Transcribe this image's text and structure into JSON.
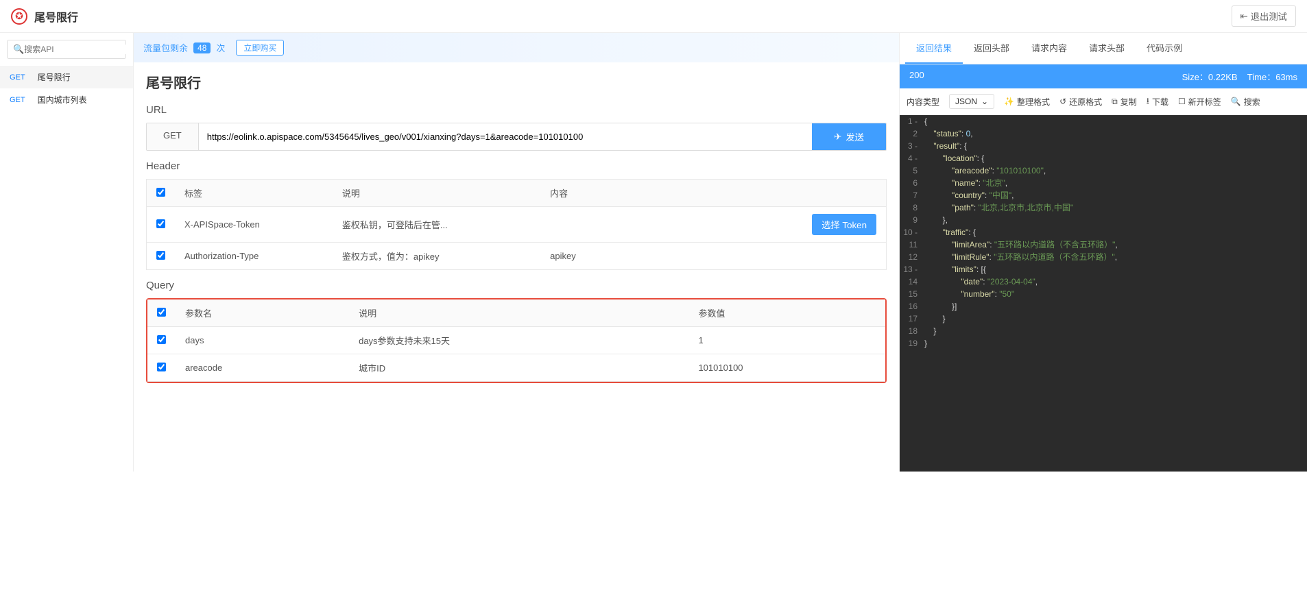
{
  "header": {
    "title": "尾号限行",
    "exit_label": "退出测试"
  },
  "sidebar": {
    "search_placeholder": "搜索API",
    "items": [
      {
        "method": "GET",
        "name": "尾号限行",
        "active": true
      },
      {
        "method": "GET",
        "name": "国内城市列表",
        "active": false
      }
    ]
  },
  "banner": {
    "label": "流量包剩余",
    "count": "48",
    "unit": "次",
    "buy_label": "立即购买"
  },
  "request": {
    "page_title": "尾号限行",
    "url_label": "URL",
    "method": "GET",
    "url": "https://eolink.o.apispace.com/5345645/lives_geo/v001/xianxing?days=1&areacode=101010100",
    "send_label": "发送",
    "header_label": "Header",
    "query_label": "Query",
    "header_table": {
      "cols": [
        "标签",
        "说明",
        "内容"
      ],
      "rows": [
        {
          "tag": "X-APISpace-Token",
          "desc": "鉴权私钥，可登陆后在管...",
          "val": "",
          "token_btn": "选择 Token"
        },
        {
          "tag": "Authorization-Type",
          "desc": "鉴权方式，值为：apikey",
          "val": "apikey"
        }
      ]
    },
    "query_table": {
      "cols": [
        "参数名",
        "说明",
        "参数值"
      ],
      "rows": [
        {
          "name": "days",
          "desc": "days参数支持未来15天",
          "val": "1"
        },
        {
          "name": "areacode",
          "desc": "城市ID",
          "val": "101010100"
        }
      ]
    }
  },
  "response": {
    "tabs": [
      "返回结果",
      "返回头部",
      "请求内容",
      "请求头部",
      "代码示例"
    ],
    "status_code": "200",
    "size_label": "Size：0.22KB",
    "time_label": "Time：63ms",
    "toolbar": {
      "content_type_label": "内容类型",
      "format_sel": "JSON",
      "format_btn": "整理格式",
      "restore_btn": "还原格式",
      "copy_btn": "复制",
      "download_btn": "下载",
      "newtab_btn": "新开标签",
      "search_btn": "搜索"
    },
    "code_lines": [
      {
        "n": "1",
        "fold": "-",
        "indent": 0,
        "tokens": [
          {
            "t": "{",
            "c": "punc"
          }
        ]
      },
      {
        "n": "2",
        "indent": 1,
        "tokens": [
          {
            "t": "\"status\"",
            "c": "key"
          },
          {
            "t": ": ",
            "c": "punc"
          },
          {
            "t": "0",
            "c": "num"
          },
          {
            "t": ",",
            "c": "punc"
          }
        ]
      },
      {
        "n": "3",
        "fold": "-",
        "indent": 1,
        "tokens": [
          {
            "t": "\"result\"",
            "c": "key"
          },
          {
            "t": ": {",
            "c": "punc"
          }
        ]
      },
      {
        "n": "4",
        "fold": "-",
        "indent": 2,
        "tokens": [
          {
            "t": "\"location\"",
            "c": "key"
          },
          {
            "t": ": {",
            "c": "punc"
          }
        ]
      },
      {
        "n": "5",
        "indent": 3,
        "tokens": [
          {
            "t": "\"areacode\"",
            "c": "key"
          },
          {
            "t": ": ",
            "c": "punc"
          },
          {
            "t": "\"101010100\"",
            "c": "str"
          },
          {
            "t": ",",
            "c": "punc"
          }
        ]
      },
      {
        "n": "6",
        "indent": 3,
        "tokens": [
          {
            "t": "\"name\"",
            "c": "key"
          },
          {
            "t": ": ",
            "c": "punc"
          },
          {
            "t": "\"北京\"",
            "c": "str"
          },
          {
            "t": ",",
            "c": "punc"
          }
        ]
      },
      {
        "n": "7",
        "indent": 3,
        "tokens": [
          {
            "t": "\"country\"",
            "c": "key"
          },
          {
            "t": ": ",
            "c": "punc"
          },
          {
            "t": "\"中国\"",
            "c": "str"
          },
          {
            "t": ",",
            "c": "punc"
          }
        ]
      },
      {
        "n": "8",
        "indent": 3,
        "tokens": [
          {
            "t": "\"path\"",
            "c": "key"
          },
          {
            "t": ": ",
            "c": "punc"
          },
          {
            "t": "\"北京,北京市,北京市,中国\"",
            "c": "str"
          }
        ]
      },
      {
        "n": "9",
        "indent": 2,
        "tokens": [
          {
            "t": "},",
            "c": "punc"
          }
        ]
      },
      {
        "n": "10",
        "fold": "-",
        "indent": 2,
        "tokens": [
          {
            "t": "\"traffic\"",
            "c": "key"
          },
          {
            "t": ": {",
            "c": "punc"
          }
        ]
      },
      {
        "n": "11",
        "indent": 3,
        "tokens": [
          {
            "t": "\"limitArea\"",
            "c": "key"
          },
          {
            "t": ": ",
            "c": "punc"
          },
          {
            "t": "\"五环路以内道路（不含五环路）\"",
            "c": "str"
          },
          {
            "t": ",",
            "c": "punc"
          }
        ]
      },
      {
        "n": "12",
        "indent": 3,
        "tokens": [
          {
            "t": "\"limitRule\"",
            "c": "key"
          },
          {
            "t": ": ",
            "c": "punc"
          },
          {
            "t": "\"五环路以内道路（不含五环路）\"",
            "c": "str"
          },
          {
            "t": ",",
            "c": "punc"
          }
        ]
      },
      {
        "n": "13",
        "fold": "-",
        "indent": 3,
        "tokens": [
          {
            "t": "\"limits\"",
            "c": "key"
          },
          {
            "t": ": [{",
            "c": "punc"
          }
        ]
      },
      {
        "n": "14",
        "indent": 4,
        "tokens": [
          {
            "t": "\"date\"",
            "c": "key"
          },
          {
            "t": ": ",
            "c": "punc"
          },
          {
            "t": "\"2023-04-04\"",
            "c": "str"
          },
          {
            "t": ",",
            "c": "punc"
          }
        ]
      },
      {
        "n": "15",
        "indent": 4,
        "tokens": [
          {
            "t": "\"number\"",
            "c": "key"
          },
          {
            "t": ": ",
            "c": "punc"
          },
          {
            "t": "\"50\"",
            "c": "str"
          }
        ]
      },
      {
        "n": "16",
        "indent": 3,
        "tokens": [
          {
            "t": "}]",
            "c": "punc"
          }
        ]
      },
      {
        "n": "17",
        "indent": 2,
        "tokens": [
          {
            "t": "}",
            "c": "punc"
          }
        ]
      },
      {
        "n": "18",
        "indent": 1,
        "tokens": [
          {
            "t": "}",
            "c": "punc"
          }
        ]
      },
      {
        "n": "19",
        "indent": 0,
        "tokens": [
          {
            "t": "}",
            "c": "punc"
          }
        ]
      }
    ]
  }
}
